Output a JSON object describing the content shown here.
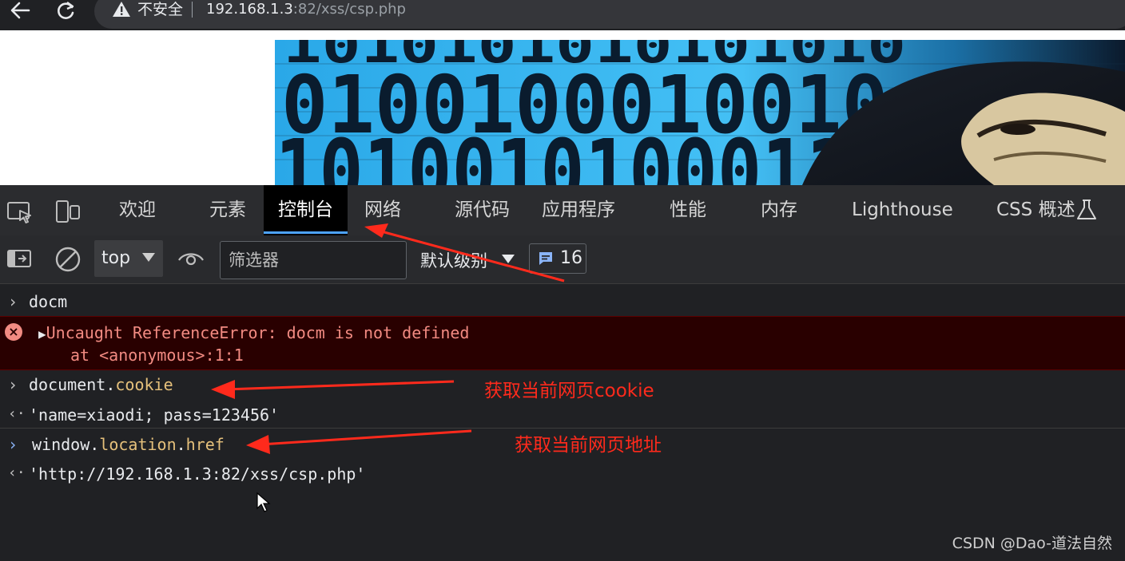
{
  "browser": {
    "security_label": "不安全",
    "url_host": "192.168.1.3",
    "url_rest": ":82/xss/csp.php"
  },
  "devtools": {
    "tabs": [
      "欢迎",
      "元素",
      "控制台",
      "网络",
      "源代码",
      "应用程序",
      "性能",
      "内存",
      "Lighthouse",
      "CSS 概述"
    ],
    "active_tab": "控制台"
  },
  "toolbar": {
    "context": "top",
    "filter_placeholder": "筛选器",
    "level": "默认级别",
    "issues_count": "16"
  },
  "console": {
    "input1": "docm",
    "error_line1": "Uncaught ReferenceError: docm is not defined",
    "error_line2": "at <anonymous>:1:1",
    "input2_obj": "document.",
    "input2_prop": "cookie",
    "output2": "'name=xiaodi; pass=123456'",
    "input3_obj": "window.",
    "input3_prop1": "location",
    "input3_dot": ".",
    "input3_prop2": "href",
    "output3": "'http://192.168.1.3:82/xss/csp.php'"
  },
  "annotations": {
    "note1": "获取当前网页cookie",
    "note2": "获取当前网页地址"
  },
  "watermark": "CSDN @Dao-道法自然",
  "colors": {
    "annotation_red": "#ff2a1c",
    "error_text": "#f28b82",
    "active_tab_underline": "#4da3ff"
  }
}
